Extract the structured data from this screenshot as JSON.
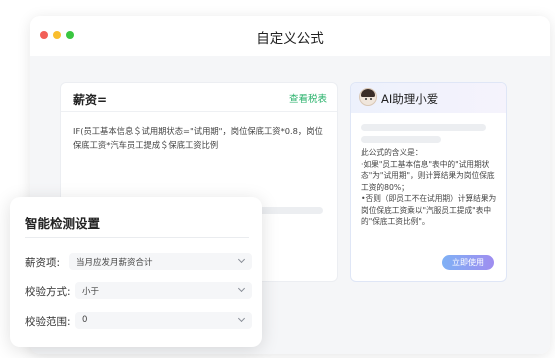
{
  "window": {
    "title": "自定义公式"
  },
  "formula_card": {
    "title": "薪资=",
    "tax_table_link": "查看税表",
    "formula": "IF(员工基本信息＄试用期状态=\"试用期\"，岗位保底工资*0.8，岗位保底工资*汽车员工提成＄保底工资比例"
  },
  "ai_card": {
    "name": "AI助理小爱",
    "lines": [
      "此公式的含义是：",
      "·如果\"员工基本信息\"表中的\"试用期状态\"为\"试用期\"，则计算结果为岗位保底工资的80%；",
      "•否则（即员工不在试用期）计算结果为岗位保底工资乘以\"汽服员工提成\"表中的\"保底工资比例\"。"
    ],
    "use_button": "立即使用"
  },
  "settings": {
    "title": "智能检测设置",
    "rows": [
      {
        "label": "薪资项:",
        "value": "当月应发月薪资合计"
      },
      {
        "label": "校验方式:",
        "value": "小于"
      },
      {
        "label": "校验范围:",
        "value": "0"
      }
    ]
  },
  "colors": {
    "link_green": "#29b26b",
    "button_gradient_start": "#7fb1f5",
    "button_gradient_end": "#9f8df0"
  }
}
